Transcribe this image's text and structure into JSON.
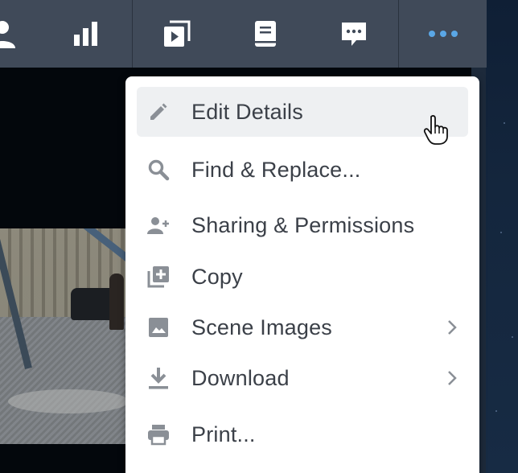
{
  "toolbar": {
    "buttons": [
      {
        "name": "user",
        "icon": "user-icon"
      },
      {
        "name": "stats",
        "icon": "bar-chart-icon"
      },
      {
        "name": "slideshow",
        "icon": "slideshow-icon"
      },
      {
        "name": "book",
        "icon": "book-icon"
      },
      {
        "name": "comments",
        "icon": "comment-icon"
      },
      {
        "name": "more",
        "icon": "more-dots-icon"
      }
    ]
  },
  "menu": {
    "items": [
      {
        "label": "Edit Details",
        "icon": "pencil-icon",
        "highlighted": true,
        "submenu": false
      },
      {
        "label": "Find & Replace...",
        "icon": "search-icon",
        "submenu": false
      },
      {
        "label": "Sharing & Permissions",
        "icon": "add-user-icon",
        "submenu": false
      },
      {
        "label": "Copy",
        "icon": "copy-plus-icon",
        "submenu": false
      },
      {
        "label": "Scene Images",
        "icon": "image-icon",
        "submenu": true
      },
      {
        "label": "Download",
        "icon": "download-icon",
        "submenu": true
      },
      {
        "label": "Print...",
        "icon": "printer-icon",
        "submenu": false
      }
    ]
  },
  "colors": {
    "toolbar_bg": "#404a59",
    "toolbar_icon": "#ffffff",
    "more_icon": "#5aa7e6",
    "menu_bg": "#ffffff",
    "menu_text": "#3b4048",
    "menu_icon": "#8a8f96",
    "highlight_bg": "#eef0f2"
  }
}
